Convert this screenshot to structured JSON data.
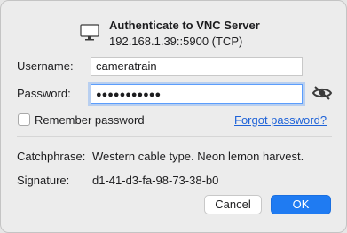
{
  "dialog": {
    "title": "Authenticate to VNC Server",
    "subtitle": "192.168.1.39::5900 (TCP)",
    "icon": "monitor-icon"
  },
  "form": {
    "username_label": "Username:",
    "username_value": "cameratrain",
    "password_label": "Password:",
    "password_masked": "●●●●●●●●●●●",
    "show_password_icon": "eye-slash-icon",
    "remember_label": "Remember password",
    "remember_checked": false,
    "forgot_link": "Forgot password?"
  },
  "info": {
    "catchphrase_label": "Catchphrase:",
    "catchphrase_value": "Western cable type. Neon lemon harvest.",
    "signature_label": "Signature:",
    "signature_value": "d1-41-d3-fa-98-73-38-b0"
  },
  "buttons": {
    "cancel": "Cancel",
    "ok": "OK"
  },
  "colors": {
    "accent": "#1f7bf2",
    "link": "#1f63d8",
    "focus_ring": "#5b9dfc"
  }
}
